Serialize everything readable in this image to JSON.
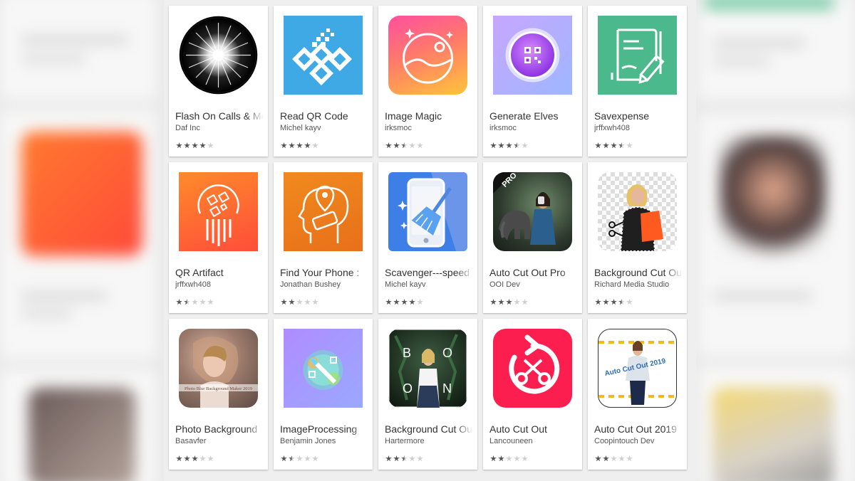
{
  "apps": [
    {
      "title": "Flash On Calls & Messages",
      "developer": "Daf Inc",
      "rating": 4,
      "icon": "flash-burst-icon"
    },
    {
      "title": "Read QR Code",
      "developer": "Michel kayv",
      "rating": 4,
      "icon": "qr-dna-icon"
    },
    {
      "title": "Image Magic",
      "developer": "irksmoc",
      "rating": 2.5,
      "icon": "landscape-circle-icon"
    },
    {
      "title": "Generate Elves",
      "developer": "irksmoc",
      "rating": 3.5,
      "icon": "qr-orb-icon"
    },
    {
      "title": "Savexpense",
      "developer": "jrffxwh408",
      "rating": 3.5,
      "icon": "note-pencil-icon"
    },
    {
      "title": "QR Artifact",
      "developer": "jrffxwh408",
      "rating": 1.5,
      "icon": "qr-circle-icon"
    },
    {
      "title": "Find Your Phone :",
      "developer": "Jonathan Bushey",
      "rating": 2,
      "icon": "head-location-icon"
    },
    {
      "title": "Scavenger---speed",
      "developer": "Michel kayv",
      "rating": 4,
      "icon": "phone-broom-icon"
    },
    {
      "title": "Auto Cut Out Pro",
      "developer": "OOI Dev",
      "rating": 3,
      "icon": "photo-elephant-icon"
    },
    {
      "title": "Background Cut Out",
      "developer": "Richard Media Studio",
      "rating": 3.5,
      "icon": "cutout-person-icon"
    },
    {
      "title": "Photo Background",
      "developer": "Basavfer",
      "rating": 3,
      "icon": "blur-portrait-icon"
    },
    {
      "title": "ImageProcessing",
      "developer": "Benjamin Jones",
      "rating": 1.5,
      "icon": "magic-wand-icon"
    },
    {
      "title": "Background Cut Out",
      "developer": "Hartermore",
      "rating": 2.5,
      "icon": "boon-photo-icon"
    },
    {
      "title": "Auto Cut Out",
      "developer": "Lancouneen",
      "rating": 2,
      "icon": "scissors-cycle-icon"
    },
    {
      "title": "Auto Cut Out 2019",
      "developer": "Coopintouch Dev",
      "rating": 2,
      "icon": "cutout-2019-icon"
    }
  ],
  "icon_texts": {
    "pro": "PRO",
    "boon": [
      "B",
      "O",
      "O",
      "N"
    ],
    "cutout2019": "Auto Cut Out 2019",
    "blurlabel": "Photo Blur Background Maker 2019"
  }
}
